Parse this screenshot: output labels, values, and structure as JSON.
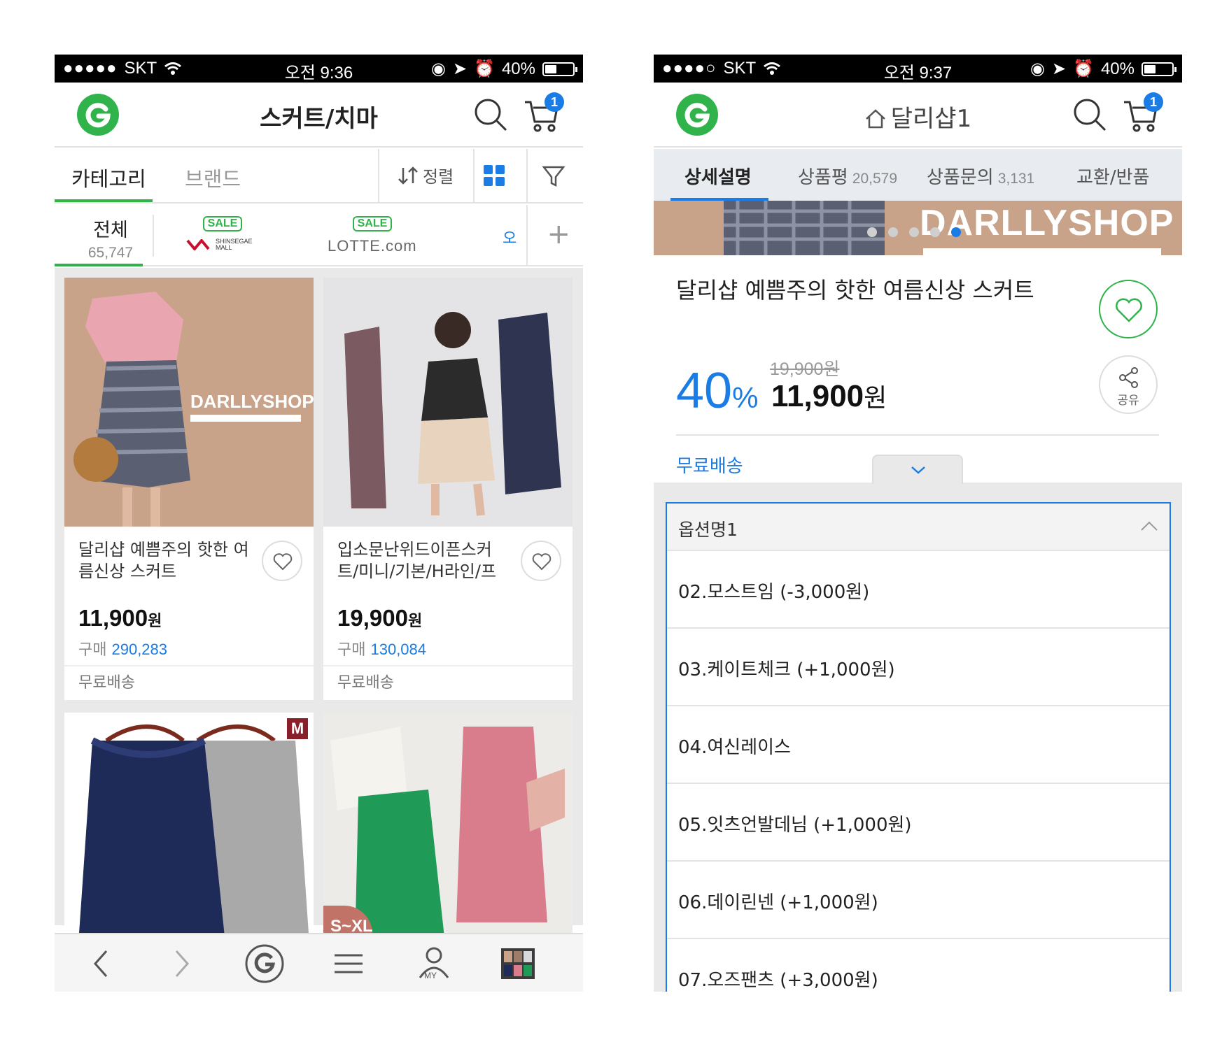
{
  "left": {
    "status": {
      "carrier": "SKT",
      "time": "오전 9:36",
      "battery": "40%"
    },
    "header": {
      "title": "스커트/치마",
      "cart_count": "1"
    },
    "tabs": {
      "category": "카테고리",
      "brand": "브랜드",
      "sort": "정렬"
    },
    "filters": {
      "all_label": "전체",
      "all_count": "65,747",
      "sale_badge": "SALE",
      "store1": "SHINSEGAE MALL",
      "store2": "LOTTE.com",
      "store3_partial": "오"
    },
    "products": [
      {
        "name": "달리샵 예쁨주의 핫한 여름신상 스커트",
        "price": "11,900",
        "unit": "원",
        "buy_label": "구매",
        "buy_count": "290,283",
        "shipping": "무료배송",
        "image_text": "DARLLYSHOP"
      },
      {
        "name": "입소문난위드이픈스커트/미니/기본/H라인/프",
        "price": "19,900",
        "unit": "원",
        "buy_label": "구매",
        "buy_count": "130,084",
        "shipping": "무료배송"
      },
      {
        "badge": "M"
      },
      {
        "badge": "S~XL"
      }
    ],
    "bottom_nav": {
      "my_label": "MY"
    }
  },
  "right": {
    "status": {
      "carrier": "SKT",
      "time": "오전 9:37",
      "battery": "40%"
    },
    "header": {
      "title": "달리샵1",
      "cart_count": "1"
    },
    "tabs": [
      {
        "label": "상세설명",
        "count": ""
      },
      {
        "label": "상품평",
        "count": "20,579"
      },
      {
        "label": "상품문의",
        "count": "3,131"
      },
      {
        "label": "교환/반품",
        "count": ""
      }
    ],
    "banner_text": "DARLLYSHOP",
    "product": {
      "title": "달리샵 예쁨주의 핫한 여름신상 스커트",
      "original_price": "19,900원",
      "discount": "40",
      "discount_unit": "%",
      "price": "11,900",
      "price_unit": "원",
      "shipping": "무료배송",
      "share_label": "공유"
    },
    "options": {
      "header": "옵션명1",
      "items": [
        "02.모스트임 (-3,000원)",
        "03.케이트체크 (+1,000원)",
        "04.여신레이스",
        "05.잇츠언발데님 (+1,000원)",
        "06.데이린넨 (+1,000원)",
        "07.오즈팬츠 (+3,000원)"
      ]
    }
  },
  "colors": {
    "green": "#2fb34a",
    "blue": "#1b7ce6"
  }
}
